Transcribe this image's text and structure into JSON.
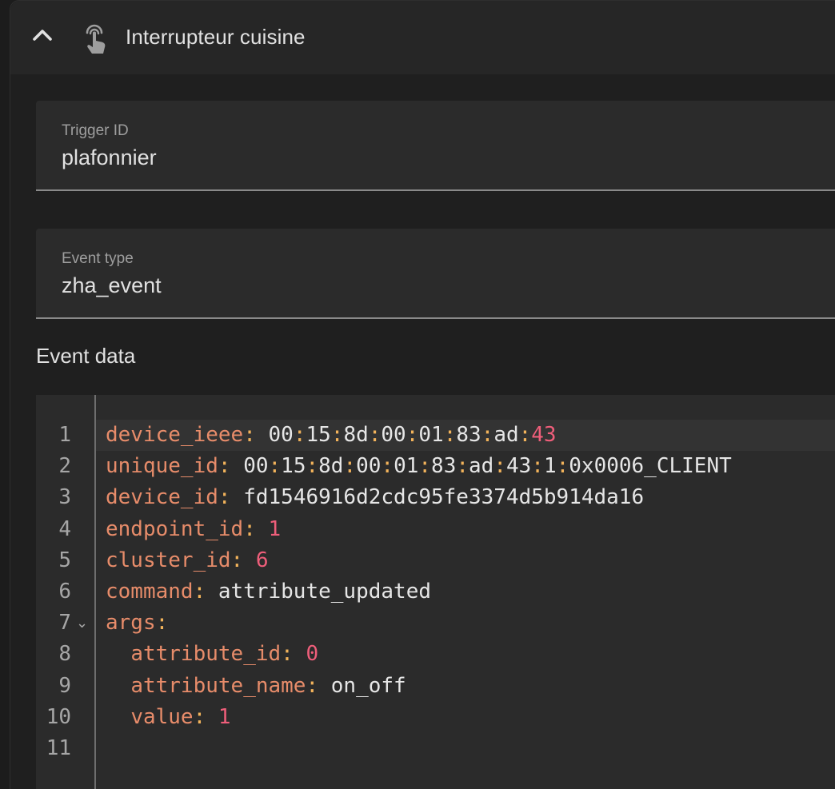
{
  "header": {
    "title": "Interrupteur cuisine",
    "collapse_icon": "chevron-up-icon",
    "trigger_icon": "gesture-tap-icon"
  },
  "trigger_id": {
    "label": "Trigger ID",
    "value": "plafonnier"
  },
  "event_type": {
    "label": "Event type",
    "value": "zha_event"
  },
  "event_data": {
    "title": "Event data",
    "lines": [
      {
        "number": "1",
        "indent": "",
        "key": "device_ieee",
        "value": "00:15:8d:00:01:83:ad:43",
        "type": "mac_num"
      },
      {
        "number": "2",
        "indent": "",
        "key": "unique_id",
        "value": "00:15:8d:00:01:83:ad:43:1:0x0006_CLIENT",
        "type": "mac"
      },
      {
        "number": "3",
        "indent": "",
        "key": "device_id",
        "value": "fd1546916d2cdc95fe3374d5b914da16",
        "type": "string"
      },
      {
        "number": "4",
        "indent": "",
        "key": "endpoint_id",
        "value": "1",
        "type": "number"
      },
      {
        "number": "5",
        "indent": "",
        "key": "cluster_id",
        "value": "6",
        "type": "number"
      },
      {
        "number": "6",
        "indent": "",
        "key": "command",
        "value": "attribute_updated",
        "type": "string"
      },
      {
        "number": "7",
        "indent": "",
        "key": "args",
        "value": "",
        "type": "object",
        "foldable": true
      },
      {
        "number": "8",
        "indent": "  ",
        "key": "attribute_id",
        "value": "0",
        "type": "number"
      },
      {
        "number": "9",
        "indent": "  ",
        "key": "attribute_name",
        "value": "on_off",
        "type": "string"
      },
      {
        "number": "10",
        "indent": "  ",
        "key": "value",
        "value": "1",
        "type": "number"
      },
      {
        "number": "11",
        "indent": "",
        "key": "",
        "value": "",
        "type": "empty"
      }
    ],
    "fold_glyph": "⌄"
  },
  "colors": {
    "key": "#e78c6a",
    "punctuation": "#f2b35b",
    "string": "#e6e6e6",
    "number": "#ee5e7a"
  }
}
